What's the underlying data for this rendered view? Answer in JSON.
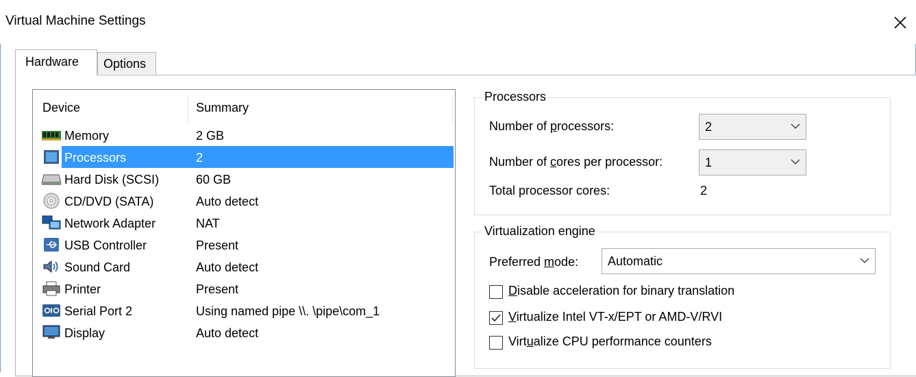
{
  "window": {
    "title": "Virtual Machine Settings"
  },
  "tabs": [
    {
      "label": "Hardware",
      "active": true
    },
    {
      "label": "Options",
      "active": false
    }
  ],
  "device_list": {
    "columns": {
      "device": "Device",
      "summary": "Summary"
    },
    "rows": [
      {
        "name": "Memory",
        "summary": "2 GB",
        "icon": "memory-icon"
      },
      {
        "name": "Processors",
        "summary": "2",
        "icon": "processor-icon",
        "selected": true
      },
      {
        "name": "Hard Disk (SCSI)",
        "summary": "60 GB",
        "icon": "hard-disk-icon"
      },
      {
        "name": "CD/DVD (SATA)",
        "summary": "Auto detect",
        "icon": "cd-dvd-icon"
      },
      {
        "name": "Network Adapter",
        "summary": "NAT",
        "icon": "network-adapter-icon"
      },
      {
        "name": "USB Controller",
        "summary": "Present",
        "icon": "usb-icon"
      },
      {
        "name": "Sound Card",
        "summary": "Auto detect",
        "icon": "sound-card-icon"
      },
      {
        "name": "Printer",
        "summary": "Present",
        "icon": "printer-icon"
      },
      {
        "name": "Serial Port 2",
        "summary": "Using named pipe \\\\. \\pipe\\com_1",
        "icon": "serial-port-icon"
      },
      {
        "name": "Display",
        "summary": "Auto detect",
        "icon": "display-icon"
      }
    ]
  },
  "processors": {
    "group_title": "Processors",
    "num_processors_label_pre": "Number of ",
    "num_processors_label_key": "p",
    "num_processors_label_post": "rocessors:",
    "num_processors_value": "2",
    "cores_label_pre": "Number of ",
    "cores_label_key": "c",
    "cores_label_post": "ores per processor:",
    "cores_value": "1",
    "total_label": "Total processor cores:",
    "total_value": "2"
  },
  "virtualization": {
    "group_title": "Virtualization engine",
    "mode_label_pre": "Preferred ",
    "mode_label_key": "m",
    "mode_label_post": "ode:",
    "mode_value": "Automatic",
    "checkboxes": [
      {
        "key": "D",
        "rest": "isable acceleration for binary translation",
        "checked": false
      },
      {
        "key": "V",
        "rest": "irtualize Intel VT-x/EPT or AMD-V/RVI",
        "checked": true
      },
      {
        "pre": "Virt",
        "key": "u",
        "rest": "alize CPU performance counters",
        "checked": false
      }
    ]
  }
}
